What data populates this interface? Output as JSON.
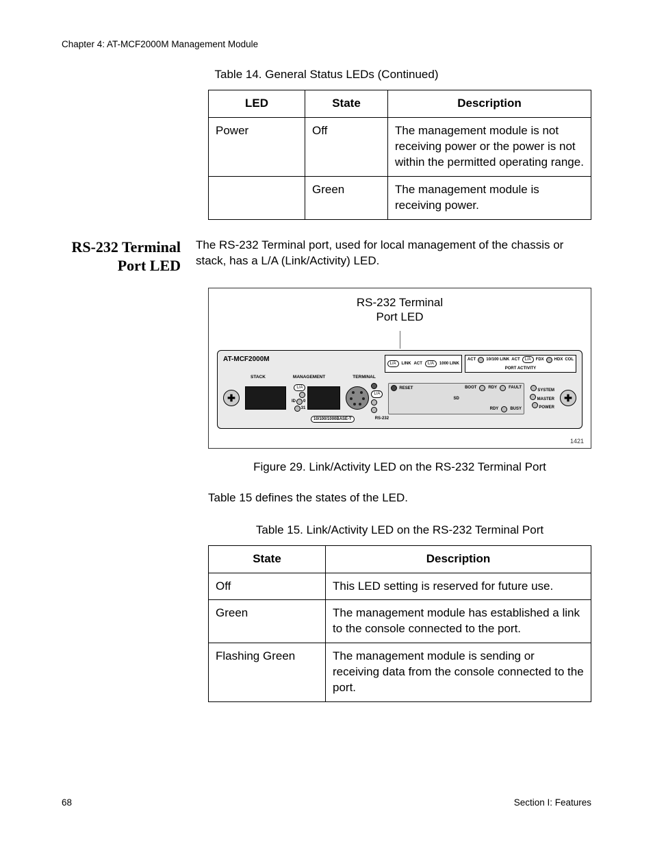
{
  "header": {
    "chapter": "Chapter 4: AT-MCF2000M Management Module"
  },
  "table14": {
    "caption": "Table 14. General Status LEDs (Continued)",
    "cols": {
      "c1": "LED",
      "c2": "State",
      "c3": "Description"
    },
    "rows": [
      {
        "led": "Power",
        "state": "Off",
        "desc": "The management module is not receiving power or the power is not within the permitted operating range."
      },
      {
        "led": "",
        "state": "Green",
        "desc": "The management module is receiving power."
      }
    ]
  },
  "section": {
    "heading": "RS-232 Terminal Port LED",
    "intro": "The RS-232 Terminal port, used for local management of the chassis or stack, has a L/A (Link/Activity) LED."
  },
  "figure": {
    "callout_title_l1": "RS-232 Terminal",
    "callout_title_l2": "Port LED",
    "device_name": "AT-MCF2000M",
    "legend1": {
      "la": "L/A",
      "link": "LINK",
      "act": "ACT",
      "la2": "L/A",
      "link1000": "1000 LINK"
    },
    "legend2": {
      "act": "ACT",
      "t10_100": "10/100 LINK",
      "act2": "ACT",
      "la": "L/A",
      "fdx": "FDX",
      "hdx": "HDX",
      "col": "COL",
      "sub": "PORT ACTIVITY"
    },
    "sections": {
      "stack": "STACK",
      "management": "MANAGEMENT",
      "terminal": "TERMINAL"
    },
    "port_labels": {
      "la": "L/A",
      "id": "ID",
      "n0": "0",
      "n31": "31",
      "base_t": "10/100/1000BASE-T",
      "rs232": "RS-232"
    },
    "reset": "RESET",
    "sd": "SD",
    "status_top": {
      "boot": "BOOT",
      "rdy": "RDY",
      "fault": "FAULT"
    },
    "status_side": {
      "system": "SYSTEM",
      "master": "MASTER",
      "power": "POWER"
    },
    "status_bottom": {
      "rdy": "RDY",
      "busy": "BUSY"
    },
    "fig_id": "1421",
    "caption": "Figure 29. Link/Activity LED on the RS-232 Terminal Port"
  },
  "para_after_figure": "Table 15 defines the states of the LED.",
  "table15": {
    "caption": "Table 15. Link/Activity LED on the RS-232 Terminal Port",
    "cols": {
      "c1": "State",
      "c2": "Description"
    },
    "rows": [
      {
        "state": "Off",
        "desc": "This LED setting is reserved for future use."
      },
      {
        "state": "Green",
        "desc": "The management module has established a link to the console connected to the port."
      },
      {
        "state": "Flashing Green",
        "desc": "The management module is sending or receiving data from the console connected to the port."
      }
    ]
  },
  "footer": {
    "page": "68",
    "section": "Section I: Features"
  }
}
